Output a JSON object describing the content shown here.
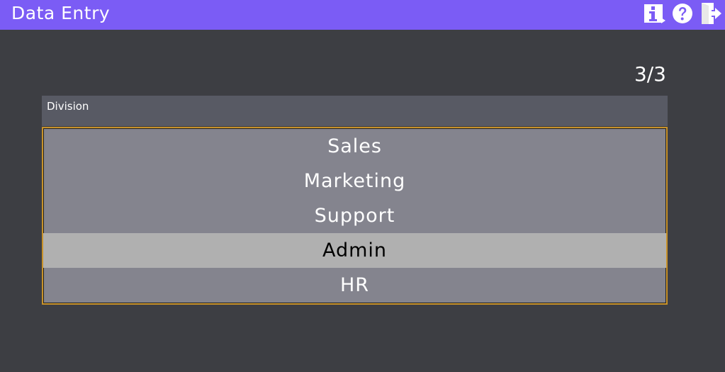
{
  "header": {
    "title": "Data Entry",
    "buttons": [
      {
        "name": "info",
        "icon": "info-icon"
      },
      {
        "name": "help",
        "icon": "help-icon"
      },
      {
        "name": "exit",
        "icon": "exit-icon"
      }
    ]
  },
  "page": {
    "counter": "3/3"
  },
  "field": {
    "label": "Division",
    "options": [
      "Sales",
      "Marketing",
      "Support",
      "Admin",
      "HR"
    ],
    "selected": "Admin"
  },
  "colors": {
    "titlebar": "#7b5cf5",
    "background": "#3d3e43",
    "field_header": "#585a64",
    "list_bg": "#84848e",
    "selected_bg": "#b0b0b0",
    "focus_border": "#c8922a"
  }
}
